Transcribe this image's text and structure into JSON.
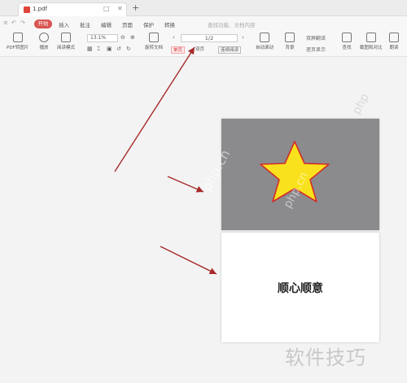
{
  "titlebar": {
    "tab_name": "1.pdf",
    "tab_icon": "pdf-file-icon",
    "new_tab": "+"
  },
  "menubar": {
    "quick_access": [
      "≡",
      "↶",
      "↷"
    ],
    "start": "开始",
    "items": [
      "插入",
      "批注",
      "编辑",
      "页面",
      "保护",
      "转换"
    ],
    "search": "查找功能、文档内容"
  },
  "toolbar": {
    "tools": [
      {
        "label": "PDF转图片",
        "icon": "image-export-icon"
      },
      {
        "label": "播放",
        "icon": "play-icon"
      },
      {
        "label": "阅读模式",
        "icon": "book-icon"
      },
      {
        "label": "旋转文档",
        "icon": "rotate-icon"
      },
      {
        "label": "自动滚动",
        "icon": "auto-scroll-icon"
      },
      {
        "label": "背景",
        "icon": "background-icon"
      },
      {
        "label": "双屏翻译",
        "icon": "translate-icon"
      },
      {
        "label": "查找",
        "icon": "find-icon"
      },
      {
        "label": "截图和对比",
        "icon": "screenshot-icon"
      },
      {
        "label": "朗读",
        "icon": "read-aloud-icon"
      }
    ],
    "zoom": "13.1%",
    "page": "1/2",
    "single_page": "单页",
    "dual_page": "双页",
    "continuous": "连续阅读",
    "order": "逐页显示"
  },
  "document": {
    "page2_text": "顺心顺意"
  },
  "watermarks": {
    "w1": "php.cn",
    "w2": "php.cn",
    "w3": "php",
    "brand": "软件技巧"
  }
}
